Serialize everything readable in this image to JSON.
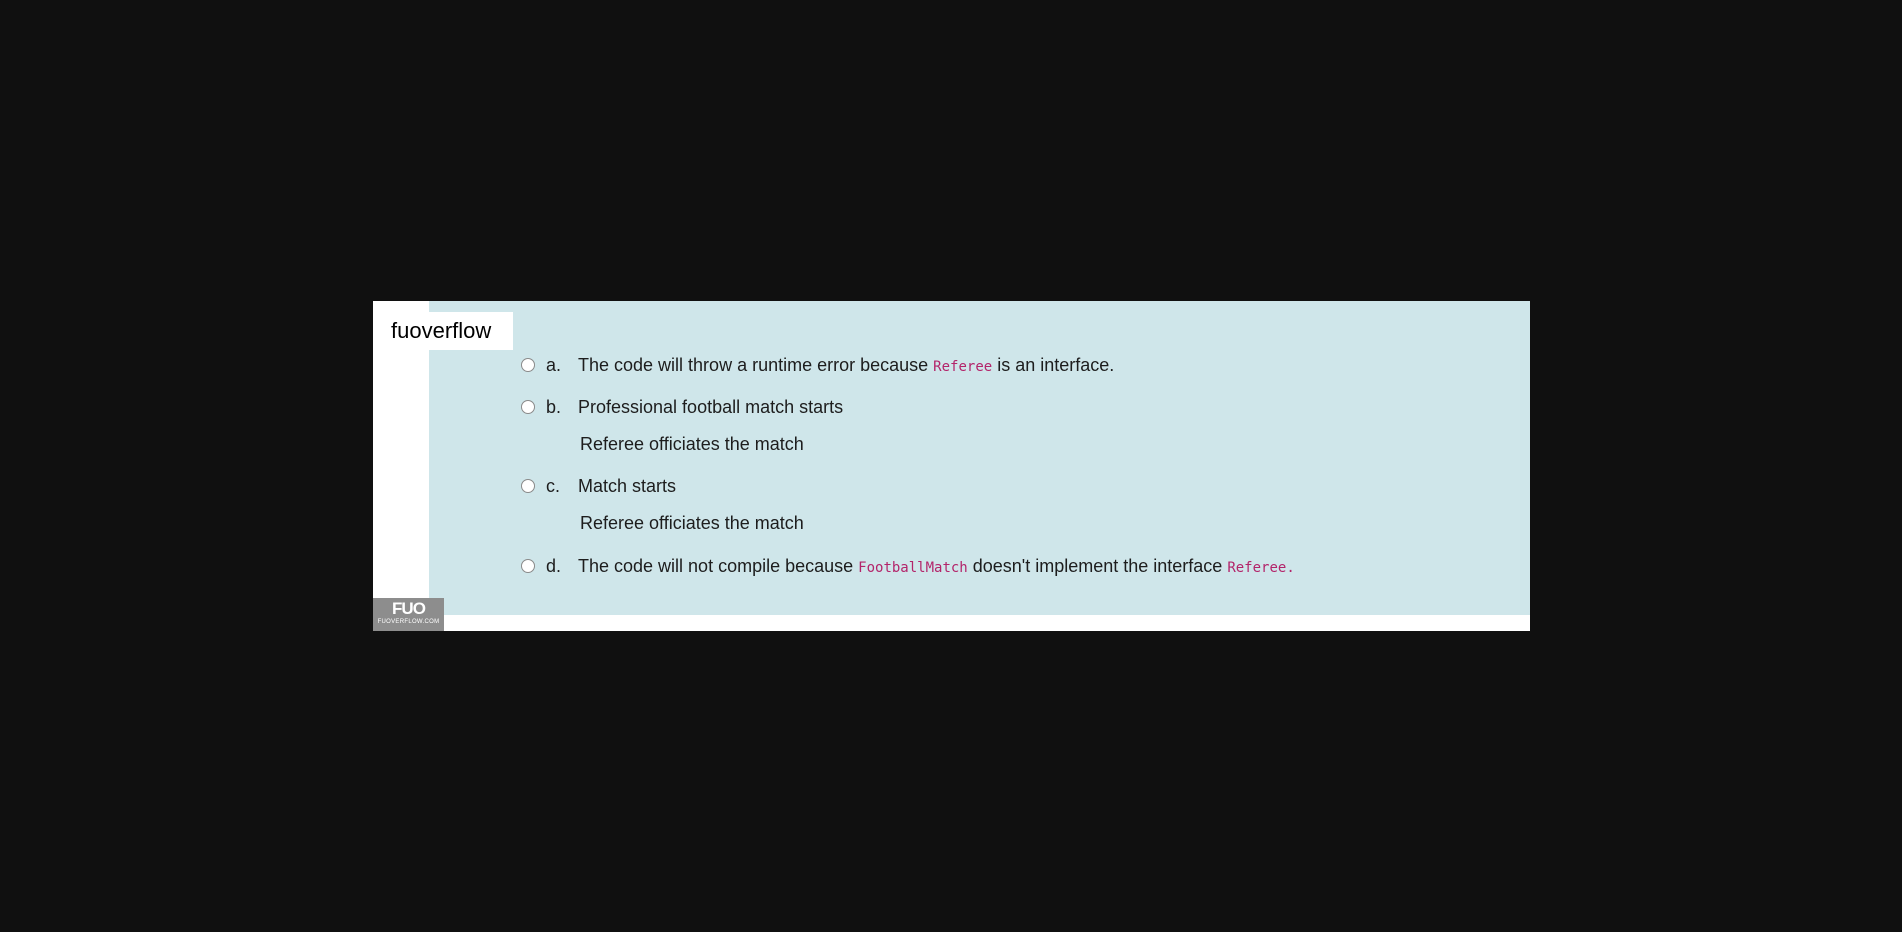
{
  "brand": "fuoverflow",
  "options": [
    {
      "letter": "a.",
      "before": "The code will throw a runtime error because ",
      "code": "Referee",
      "after": " is an interface."
    },
    {
      "letter": "b.",
      "line1": "Professional football match starts",
      "line2": "Referee officiates the match"
    },
    {
      "letter": "c.",
      "line1": "Match starts",
      "line2": "Referee officiates the match"
    },
    {
      "letter": "d.",
      "before": "The code will not compile because ",
      "code1": "FootballMatch",
      "middle": " doesn't implement the interface ",
      "code2": "Referee."
    }
  ],
  "watermark": {
    "mark": "FUO",
    "sub": "FUOVERFLOW.COM"
  },
  "colors": {
    "background": "#101010",
    "content_bg": "#cfe6ea",
    "code_text": "#b3246a"
  }
}
